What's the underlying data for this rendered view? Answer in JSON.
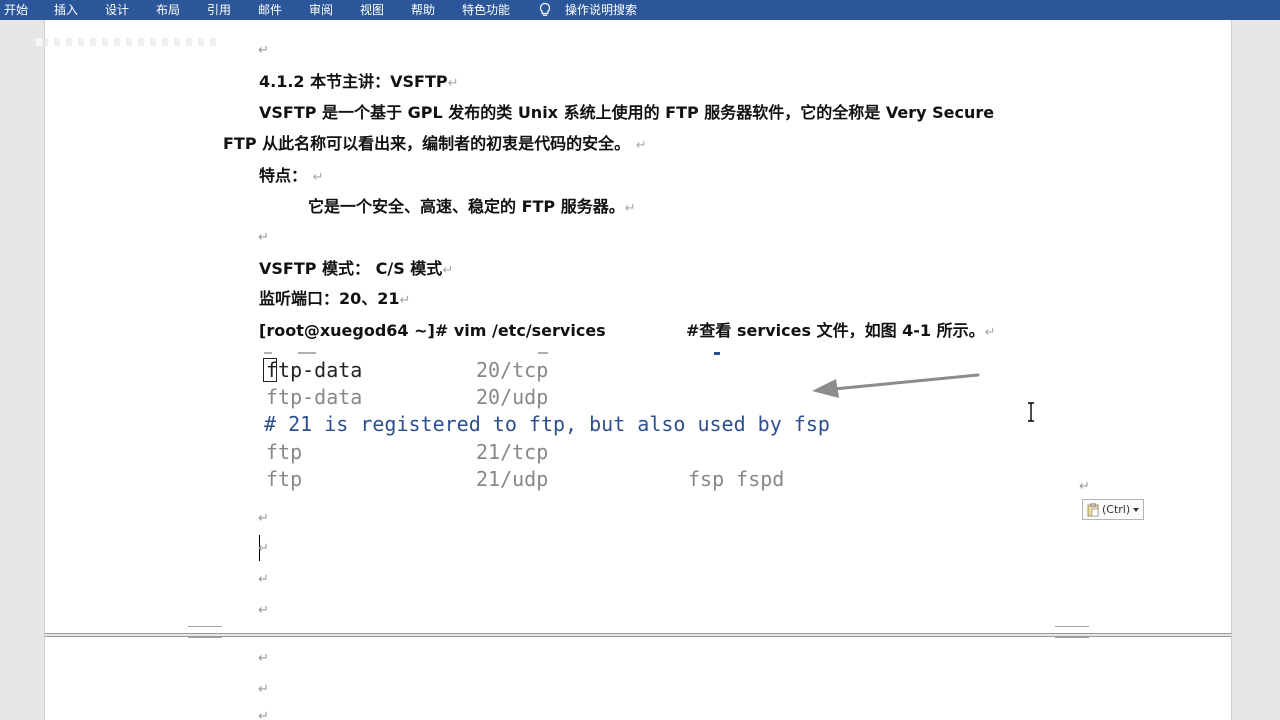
{
  "menu": {
    "tabs": [
      "开始",
      "插入",
      "设计",
      "布局",
      "引用",
      "邮件",
      "审阅",
      "视图",
      "帮助",
      "特色功能"
    ],
    "search": "操作说明搜索"
  },
  "document": {
    "heading": "4.1.2   本节主讲：VSFTP",
    "intro_line1": "VSFTP 是一个基于 GPL 发布的类 Unix 系统上使用的 FTP 服务器软件，它的全称是 Very Secure",
    "intro_line2": "FTP  从此名称可以看出来，编制者的初衷是代码的安全。",
    "features_label": "特点：",
    "features_text": "它是一个安全、高速、稳定的 FTP 服务器。",
    "mode_line": "VSFTP 模式：   C/S  模式",
    "port_line": "监听端口：20、21",
    "command": "[root@xuegod64 ~]# vim /etc/services",
    "command_comment": "#查看 services 文件，如图  4-1  所示。"
  },
  "terminal": {
    "rows": [
      {
        "name": "ftp-data",
        "port": "20/tcp",
        "alias": ""
      },
      {
        "name": "ftp-data",
        "port": "20/udp",
        "alias": ""
      },
      {
        "name": "ftp",
        "port": "21/tcp",
        "alias": ""
      },
      {
        "name": "ftp",
        "port": "21/udp",
        "alias": "fsp fspd"
      }
    ],
    "comment": "# 21 is registered to ftp, but also used by fsp"
  },
  "paragraph_mark": "↵",
  "paste_options": "(Ctrl)",
  "colors": {
    "ribbon": "#2b579a",
    "terminal_comment": "#2e4f8f",
    "terminal_text": "#888888",
    "arrow": "#8c8c8c"
  }
}
